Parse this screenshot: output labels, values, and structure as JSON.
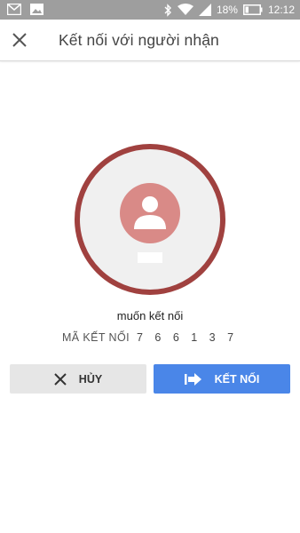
{
  "status_bar": {
    "battery": "18%",
    "time": "12:12",
    "icons": [
      "mail-icon",
      "image-icon",
      "bluetooth-icon",
      "wifi-icon",
      "signal-icon",
      "battery-icon"
    ]
  },
  "header": {
    "title": "Kết nối với người nhận",
    "close_icon": "close-icon"
  },
  "recipient": {
    "subtitle": "muốn kết nối",
    "code_label": "MÃ KẾT NỐI",
    "code_value": "7 6 6 1 3 7"
  },
  "actions": {
    "cancel_label": "HỦY",
    "connect_label": "KẾT NỐI"
  },
  "colors": {
    "ring": "#a0413f",
    "avatar": "#d98a87",
    "primary": "#4a86e8",
    "cancel_bg": "#e6e6e6",
    "status_bar": "#9e9e9e"
  }
}
